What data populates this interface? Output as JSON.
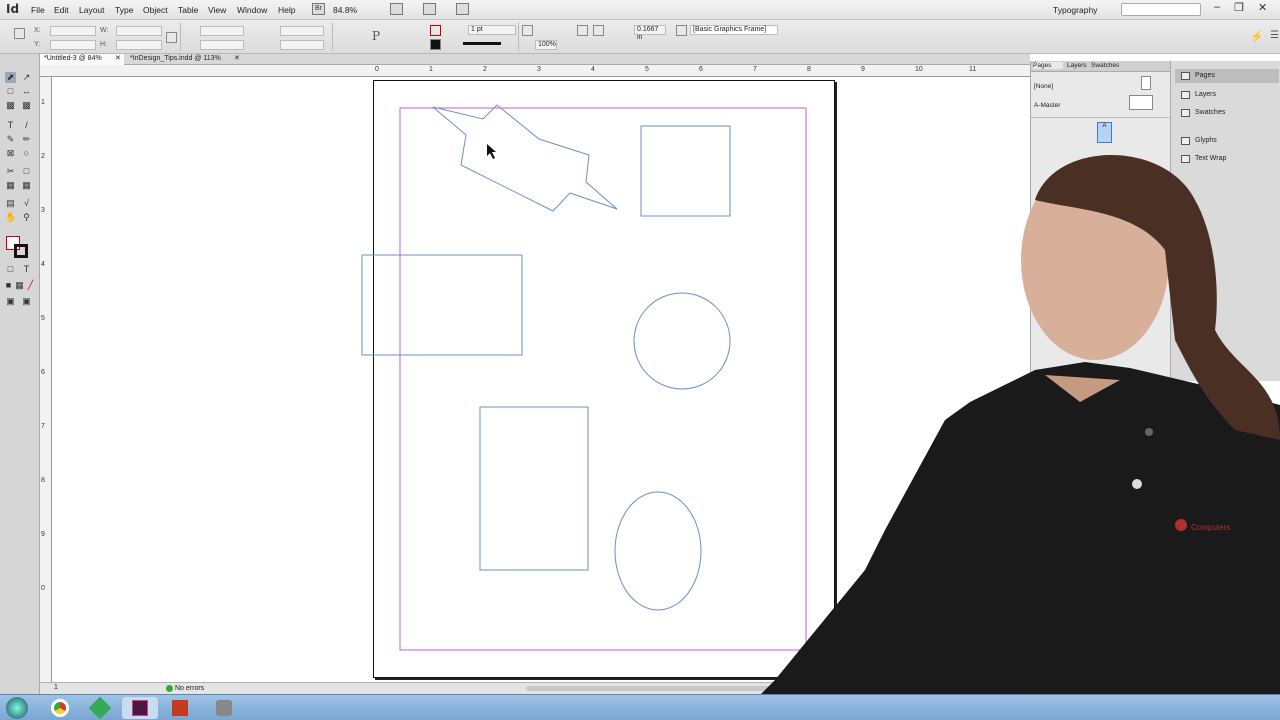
{
  "app": {
    "logo": "Id",
    "menus": [
      "File",
      "Edit",
      "Layout",
      "Type",
      "Object",
      "Table",
      "View",
      "Window",
      "Help"
    ],
    "bridge_label": "Br",
    "zoom": "84.8%",
    "workspace": "Typography"
  },
  "control": {
    "x_label": "X:",
    "y_label": "Y:",
    "w_label": "W:",
    "h_label": "H:",
    "stroke_weight": "1 pt",
    "fitting_value": "0.1667 in",
    "scale_value": "100%",
    "object_style": "[Basic Graphics Frame]",
    "p_glyph": "P"
  },
  "documents": {
    "tabs": [
      {
        "label": "*Untitled-3 @ 84%"
      },
      {
        "label": "*InDesign_Tips.indd @ 113%"
      }
    ]
  },
  "rulers": {
    "horizontal": [
      "0",
      "1",
      "2",
      "3",
      "4",
      "5",
      "6",
      "7",
      "8",
      "9",
      "10",
      "11"
    ],
    "vertical": [
      "1",
      "2",
      "3",
      "4",
      "5",
      "6",
      "7",
      "8",
      "9",
      "0"
    ]
  },
  "status": {
    "page": "1",
    "preflight": "No errors"
  },
  "pages_panel": {
    "tabs": [
      "Pages",
      "Layers",
      "Swatches"
    ],
    "none_label": "[None]",
    "master_label": "A-Master",
    "page_badge": "A"
  },
  "right_panel": {
    "items": [
      "Pages",
      "Layers",
      "Swatches",
      "Glyphs",
      "Text Wrap"
    ]
  },
  "shirt_logo": "Computers",
  "colors": {
    "frame_stroke": "#6d8fc6",
    "margin": "#c060d0",
    "taskbar": "#8db4dc"
  }
}
